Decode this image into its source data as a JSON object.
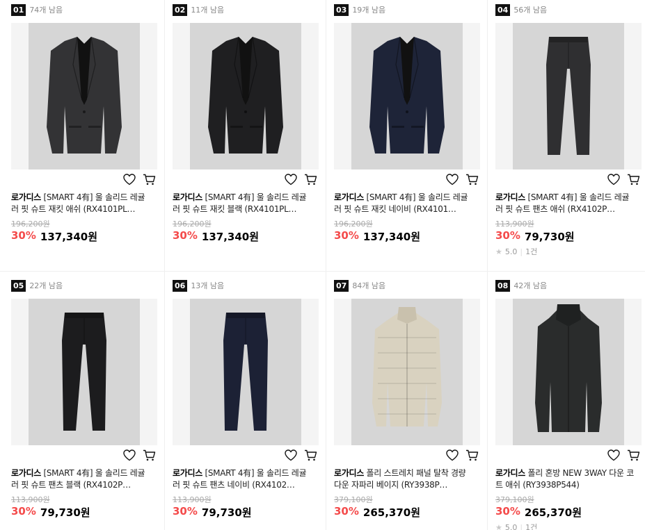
{
  "products": [
    {
      "rank": "01",
      "remaining": "74개 남음",
      "brand": "로가디스",
      "name": "[SMART 4有] 울 솔리드 레귤러 핏 슈트 재킷 애쉬 (RX4101PL…",
      "original_price": "196,200원",
      "discount": "30%",
      "price": "137,340원",
      "garment": "jacket",
      "color": "#333335",
      "rating": null,
      "reviews": null
    },
    {
      "rank": "02",
      "remaining": "11개 남음",
      "brand": "로가디스",
      "name": "[SMART 4有] 울 솔리드 레귤러 핏 슈트 재킷 블랙 (RX4101PL…",
      "original_price": "196,200원",
      "discount": "30%",
      "price": "137,340원",
      "garment": "jacket",
      "color": "#1f1f21",
      "rating": null,
      "reviews": null
    },
    {
      "rank": "03",
      "remaining": "19개 남음",
      "brand": "로가디스",
      "name": "[SMART 4有] 울 솔리드 레귤러 핏 슈트 재킷 네이비 (RX4101…",
      "original_price": "196,200원",
      "discount": "30%",
      "price": "137,340원",
      "garment": "jacket",
      "color": "#1e2438",
      "rating": null,
      "reviews": null
    },
    {
      "rank": "04",
      "remaining": "56개 남음",
      "brand": "로가디스",
      "name": "[SMART 4有] 울 솔리드 레귤러 핏 슈트 팬츠 애쉬 (RX4102P…",
      "original_price": "113,900원",
      "discount": "30%",
      "price": "79,730원",
      "garment": "pants",
      "color": "#2f2f31",
      "rating": "5.0",
      "reviews": "1건"
    },
    {
      "rank": "05",
      "remaining": "22개 남음",
      "brand": "로가디스",
      "name": "[SMART 4有] 울 솔리드 레귤러 핏 슈트 팬츠 블랙 (RX4102P…",
      "original_price": "113,900원",
      "discount": "30%",
      "price": "79,730원",
      "garment": "pants",
      "color": "#1c1c1e",
      "rating": null,
      "reviews": null
    },
    {
      "rank": "06",
      "remaining": "13개 남음",
      "brand": "로가디스",
      "name": "[SMART 4有] 울 솔리드 레귤러 핏 슈트 팬츠 네이비 (RX4102…",
      "original_price": "113,900원",
      "discount": "30%",
      "price": "79,730원",
      "garment": "pants",
      "color": "#1c2135",
      "rating": null,
      "reviews": null
    },
    {
      "rank": "07",
      "remaining": "84개 남음",
      "brand": "로가디스",
      "name": "폴리 스트레치 패널 탈착 경량 다운 자파리 베이지 (RY3938P…",
      "original_price": "379,100원",
      "discount": "30%",
      "price": "265,370원",
      "garment": "down",
      "color": "#d9d2c0",
      "rating": null,
      "reviews": null
    },
    {
      "rank": "08",
      "remaining": "42개 남음",
      "brand": "로가디스",
      "name": "폴리 혼방 NEW 3WAY 다운 코트 애쉬 (RY3938P544)",
      "original_price": "379,100원",
      "discount": "30%",
      "price": "265,370원",
      "garment": "coat",
      "color": "#2a2c2c",
      "rating": "5.0",
      "reviews": "1건"
    }
  ]
}
